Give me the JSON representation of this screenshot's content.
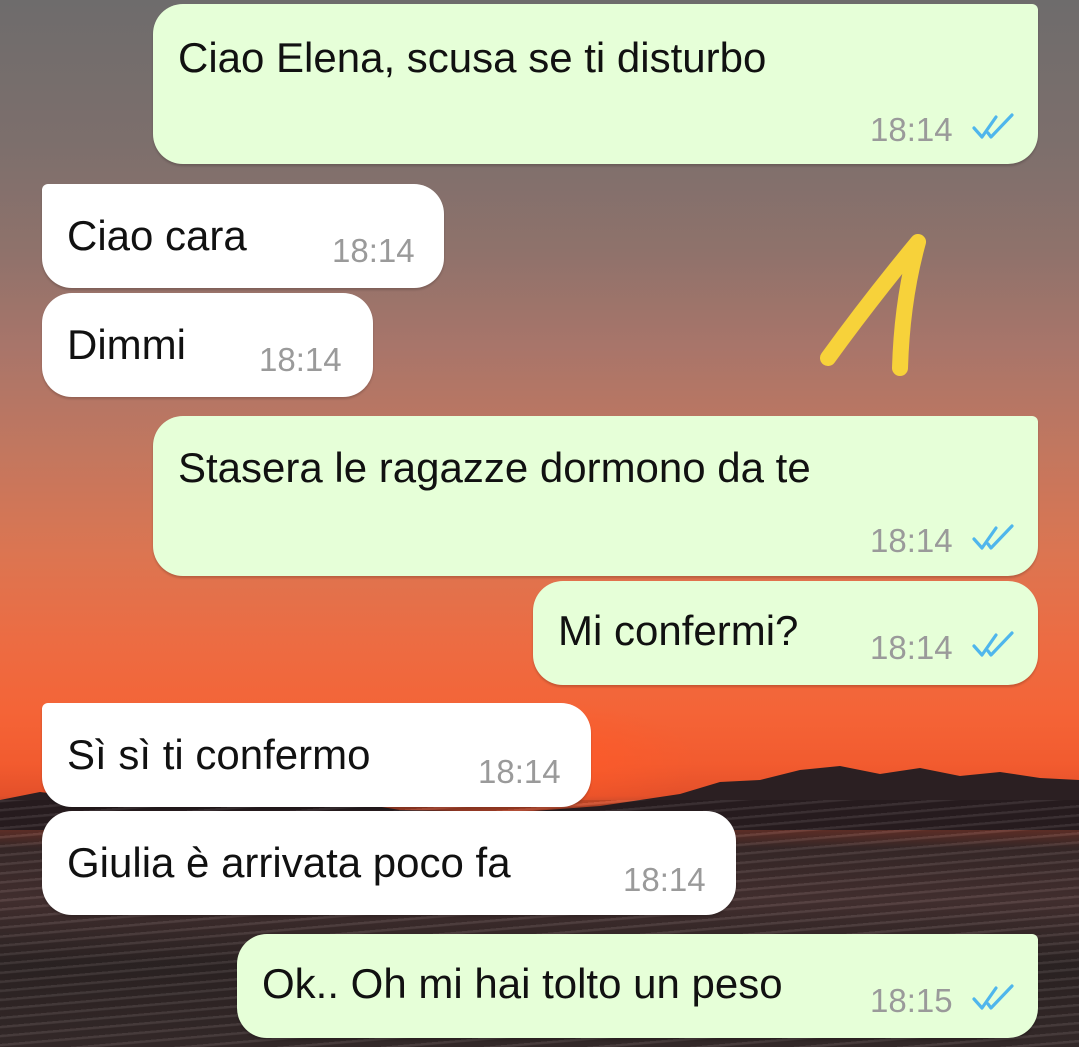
{
  "chat": {
    "messages": [
      {
        "direction": "outgoing",
        "text": "Ciao Elena,  scusa se ti disturbo",
        "time": "18:14",
        "status_icon": "double-check-icon"
      },
      {
        "direction": "incoming",
        "text": "Ciao cara",
        "time": "18:14"
      },
      {
        "direction": "incoming",
        "text": "Dimmi",
        "time": "18:14"
      },
      {
        "direction": "outgoing",
        "text": "Stasera le ragazze dormono da te",
        "time": "18:14",
        "status_icon": "double-check-icon"
      },
      {
        "direction": "outgoing",
        "text": "Mi confermi?",
        "time": "18:14",
        "status_icon": "double-check-icon"
      },
      {
        "direction": "incoming",
        "text": "Sì sì ti confermo",
        "time": "18:14"
      },
      {
        "direction": "incoming",
        "text": "Giulia è arrivata poco fa",
        "time": "18:14"
      },
      {
        "direction": "outgoing",
        "text": "Ok.. Oh mi hai tolto un peso",
        "time": "18:15",
        "status_icon": "double-check-icon"
      }
    ]
  },
  "annotation": {
    "icon": "handwritten-mark-icon",
    "color": "#f7d23a"
  },
  "colors": {
    "outgoing_bubble": "#e6ffd8",
    "incoming_bubble": "#ffffff",
    "read_ticks": "#4fb6ec",
    "timestamp": "#9a9a9a"
  }
}
